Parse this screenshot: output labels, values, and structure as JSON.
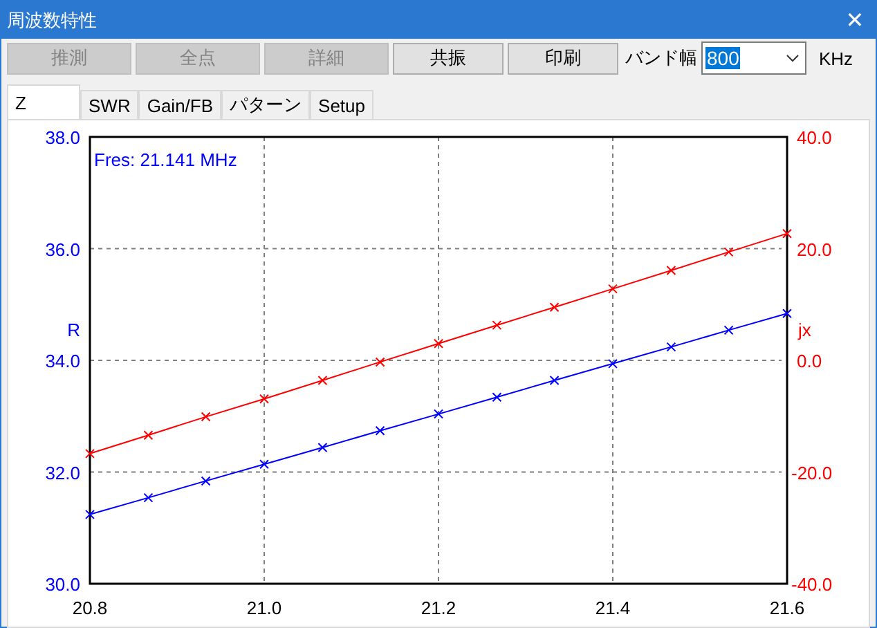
{
  "window": {
    "title": "周波数特性",
    "close": "✕"
  },
  "toolbar": {
    "buttons": [
      {
        "label": "推測",
        "disabled": true
      },
      {
        "label": "全点",
        "disabled": true
      },
      {
        "label": "詳細",
        "disabled": true
      },
      {
        "label": "共振",
        "disabled": false
      },
      {
        "label": "印刷",
        "disabled": false
      }
    ],
    "bandwidth": {
      "label": "バンド幅",
      "value": "800",
      "unit": "KHz"
    }
  },
  "tabs": [
    {
      "label": "Z",
      "selected": true
    },
    {
      "label": "SWR",
      "selected": false
    },
    {
      "label": "Gain/FB",
      "selected": false
    },
    {
      "label": "パターン",
      "selected": false
    },
    {
      "label": "Setup",
      "selected": false
    }
  ],
  "chart": {
    "chart_data": {
      "type": "line",
      "x": [
        20.8,
        20.867,
        20.933,
        21.0,
        21.067,
        21.133,
        21.2,
        21.267,
        21.333,
        21.4,
        21.467,
        21.533,
        21.6
      ],
      "series": [
        {
          "name": "R",
          "color": "#0000ff",
          "marker": "x",
          "values": [
            31.24,
            31.54,
            31.84,
            32.14,
            32.44,
            32.74,
            33.04,
            33.34,
            33.64,
            33.94,
            34.24,
            34.54,
            34.84
          ]
        },
        {
          "name": "jx",
          "color": "#ff0000",
          "axis": "y2",
          "marker": "x",
          "values": [
            -16.7,
            -13.4,
            -10.1,
            -6.9,
            -3.6,
            -0.3,
            3.0,
            6.3,
            9.5,
            12.8,
            16.1,
            19.4,
            22.7
          ]
        }
      ],
      "grid": true,
      "xlim": [
        20.8,
        21.6
      ],
      "ylim": [
        30,
        38
      ],
      "y2lim": [
        -40,
        40
      ],
      "xticks": [
        {
          "value": 20.8,
          "label": "20.8"
        },
        {
          "value": 21.0,
          "label": "21.0"
        },
        {
          "value": 21.2,
          "label": "21.2"
        },
        {
          "value": 21.4,
          "label": "21.4"
        },
        {
          "value": 21.6,
          "label": "21.6"
        }
      ],
      "yticks": [
        {
          "value": 30,
          "label": "30.0"
        },
        {
          "value": 32,
          "label": "32.0"
        },
        {
          "value": 34,
          "label": "34.0"
        },
        {
          "value": 36,
          "label": "36.0"
        },
        {
          "value": 38,
          "label": "38.0"
        }
      ],
      "y2ticks": [
        {
          "value": -40,
          "label": "-40.0"
        },
        {
          "value": -20,
          "label": "-20.0"
        },
        {
          "value": 0,
          "label": "0.0"
        },
        {
          "value": 20,
          "label": "20.0"
        },
        {
          "value": 40,
          "label": "40.0"
        }
      ],
      "annotations": [
        {
          "text": "Fres: 21.141 MHz"
        }
      ]
    }
  }
}
